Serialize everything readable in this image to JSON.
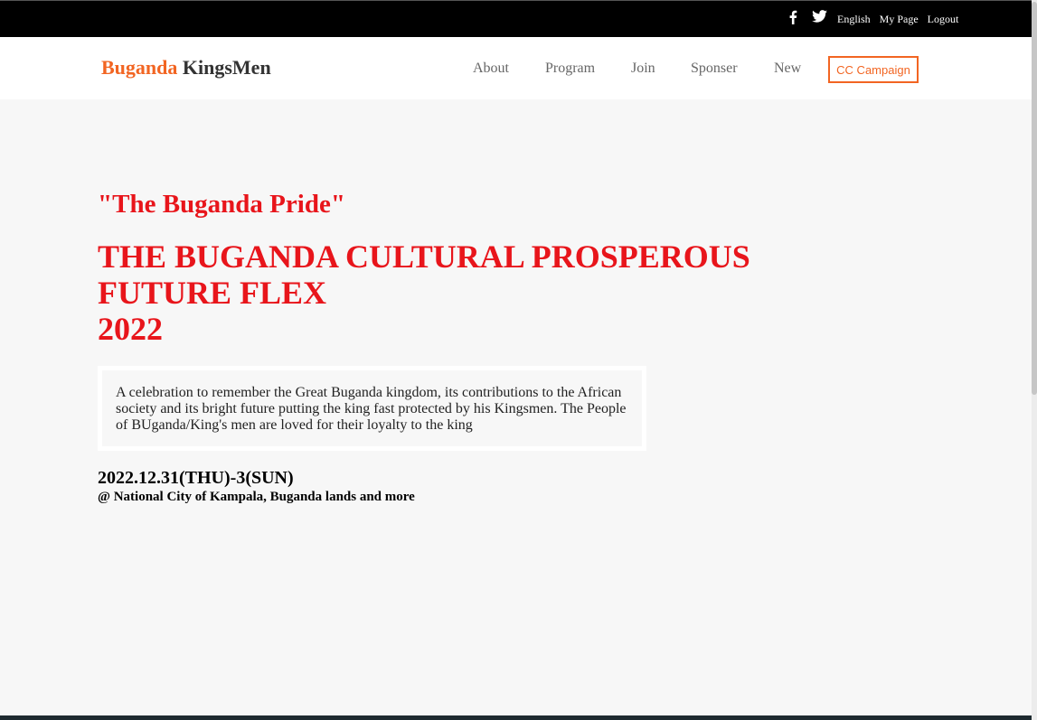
{
  "topbar": {
    "social": [
      {
        "icon": "facebook-icon"
      },
      {
        "icon": "twitter-icon"
      }
    ],
    "links": [
      "English",
      "My Page",
      "Logout"
    ]
  },
  "navbar": {
    "logo_part1": "Buganda",
    "logo_part2": "KingsMen",
    "items": [
      "About",
      "Program",
      "Join",
      "Sponser",
      "New"
    ],
    "cta": "CC Campaign"
  },
  "hero": {
    "tagline": "\"The Buganda Pride\"",
    "headline_lines": [
      "THE BUGANDA CULTURAL PROSPEROUS",
      "FUTURE FLEX",
      "2022"
    ],
    "description": "A celebration to remember the Great Buganda kingdom, its contributions to the African society and its bright future putting the king fast protected by his Kingsmen. The People of BUganda/King's men are loved for their loyalty to the king",
    "date": "2022.12.31(THU)-3(SUN)",
    "venue": "@ National City of Kampala, Buganda lands and more"
  },
  "colors": {
    "accent": "#f26522",
    "headline": "#e8151b",
    "topbar": "#000000",
    "page_bg": "#f7f7f7"
  }
}
